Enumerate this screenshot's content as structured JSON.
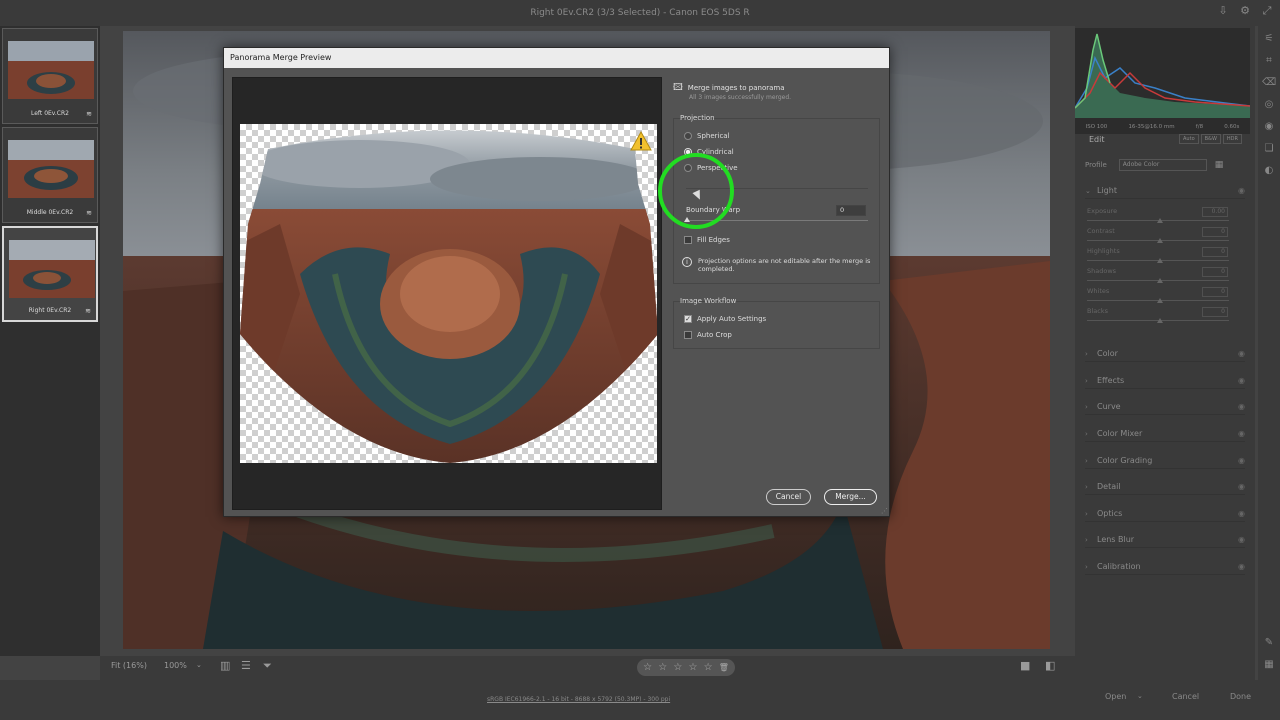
{
  "window": {
    "title": "Right 0Ev.CR2 (3/3 Selected)  -  Canon EOS 5DS R",
    "icons": [
      "export-icon",
      "settings-icon",
      "expand-icon"
    ]
  },
  "filmstrip": {
    "items": [
      {
        "label": "Left 0Ev.CR2",
        "selected": false
      },
      {
        "label": "Middle 0Ev.CR2",
        "selected": false
      },
      {
        "label": "Right 0Ev.CR2",
        "selected": true
      }
    ]
  },
  "toolbar": {
    "zoom_fit": "Fit (16%)",
    "zoom_pct": "100%",
    "rating_stars": 5
  },
  "status": {
    "info": "sRGB IEC61966-2.1 - 16 bit - 8688 x 5792 (50.3MP) - 300 ppi",
    "open": "Open",
    "cancel": "Cancel",
    "done": "Done"
  },
  "panel": {
    "histogram": {
      "iso": "ISO 100",
      "lens": "16-35@16.0 mm",
      "aperture": "f/8",
      "shutter": "0.60s"
    },
    "edit_label": "Edit",
    "edit_buttons": [
      "Auto",
      "B&W",
      "HDR"
    ],
    "profile_label": "Profile",
    "profile_value": "Adobe Color",
    "light_label": "Light",
    "light_sliders": [
      {
        "label": "Exposure",
        "value": "0.00"
      },
      {
        "label": "Contrast",
        "value": "0"
      },
      {
        "label": "Highlights",
        "value": "0"
      },
      {
        "label": "Shadows",
        "value": "0"
      },
      {
        "label": "Whites",
        "value": "0"
      },
      {
        "label": "Blacks",
        "value": "0"
      }
    ],
    "sections": [
      "Color",
      "Effects",
      "Curve",
      "Color Mixer",
      "Color Grading",
      "Detail",
      "Optics",
      "Lens Blur",
      "Calibration"
    ]
  },
  "dialog": {
    "title": "Panorama Merge Preview",
    "merge_heading": "Merge images to panorama",
    "merge_status": "All 3 images successfully merged.",
    "projection_label": "Projection",
    "projections": [
      {
        "label": "Spherical",
        "selected": false
      },
      {
        "label": "Cylindrical",
        "selected": true
      },
      {
        "label": "Perspective",
        "selected": false
      }
    ],
    "boundary_warp_label": "Boundary Warp",
    "boundary_warp_value": "0",
    "fill_edges_label": "Fill Edges",
    "fill_edges_checked": false,
    "info_text": "Projection options are not editable after the merge is completed.",
    "workflow_label": "Image Workflow",
    "apply_auto_label": "Apply Auto Settings",
    "apply_auto_checked": true,
    "auto_crop_label": "Auto Crop",
    "auto_crop_checked": false,
    "cancel_label": "Cancel",
    "merge_label": "Merge..."
  },
  "colors": {
    "highlight_ring": "#22dd22",
    "warning": "#f2c12e"
  }
}
